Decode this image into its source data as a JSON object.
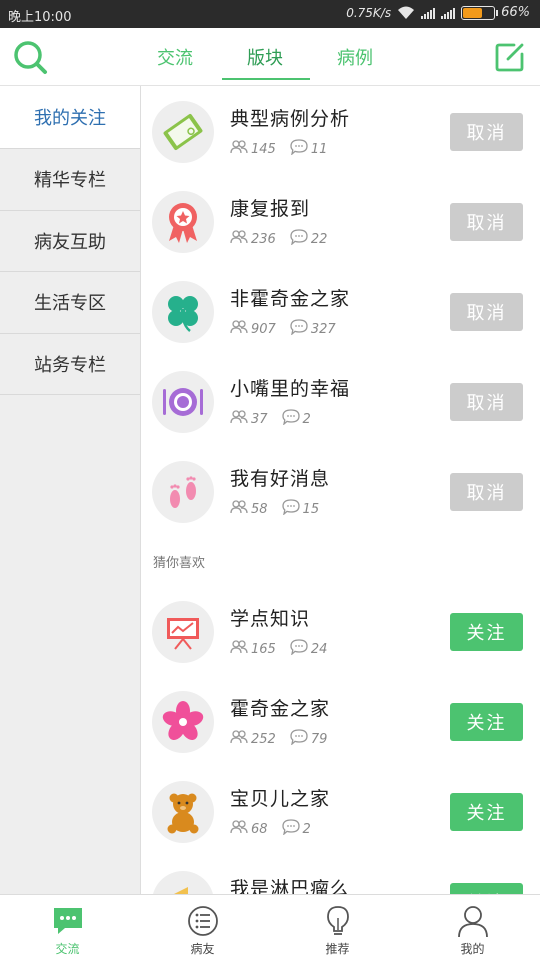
{
  "status": {
    "time": "晚上10:00",
    "network": "0.75K/s",
    "battery": "66%",
    "battery_level": 0.66
  },
  "nav": {
    "tabs": [
      {
        "label": "交流",
        "active": false
      },
      {
        "label": "版块",
        "active": true
      },
      {
        "label": "病例",
        "active": false
      }
    ],
    "icons": {
      "left": "search-icon",
      "right": "edit-icon"
    }
  },
  "sidebar": {
    "items": [
      {
        "label": "我的关注",
        "active": true
      },
      {
        "label": "精华专栏",
        "active": false
      },
      {
        "label": "病友互助",
        "active": false
      },
      {
        "label": "生活专区",
        "active": false
      },
      {
        "label": "站务专栏",
        "active": false
      }
    ]
  },
  "followed": [
    {
      "title": "典型病例分析",
      "members": "145",
      "comments": "11",
      "action": "取消",
      "icon": "book-icon",
      "color": "#8bc34a"
    },
    {
      "title": "康复报到",
      "members": "236",
      "comments": "22",
      "action": "取消",
      "icon": "ribbon-icon",
      "color": "#f06262"
    },
    {
      "title": "非霍奇金之家",
      "members": "907",
      "comments": "327",
      "action": "取消",
      "icon": "clover-icon",
      "color": "#26b08c"
    },
    {
      "title": "小嘴里的幸福",
      "members": "37",
      "comments": "2",
      "action": "取消",
      "icon": "plate-icon",
      "color": "#a66cd6"
    },
    {
      "title": "我有好消息",
      "members": "58",
      "comments": "15",
      "action": "取消",
      "icon": "footprints-icon",
      "color": "#f28bb0"
    }
  ],
  "recommend_label": "猜你喜欢",
  "recommended": [
    {
      "title": "学点知识",
      "members": "165",
      "comments": "24",
      "action": "关注",
      "icon": "presentation-icon",
      "color": "#f05a5a"
    },
    {
      "title": "霍奇金之家",
      "members": "252",
      "comments": "79",
      "action": "关注",
      "icon": "flower-icon",
      "color": "#f0509a"
    },
    {
      "title": "宝贝儿之家",
      "members": "68",
      "comments": "2",
      "action": "关注",
      "icon": "teddy-bear-icon",
      "color": "#d98a1e"
    },
    {
      "title": "我是淋巴瘤么",
      "members": "",
      "comments": "",
      "action": "关注",
      "icon": "megaphone-icon",
      "color": "#f2c14e"
    }
  ],
  "bottom_nav": [
    {
      "label": "交流",
      "icon": "chat-icon",
      "active": true
    },
    {
      "label": "病友",
      "icon": "list-icon",
      "active": false
    },
    {
      "label": "推荐",
      "icon": "bulb-icon",
      "active": false
    },
    {
      "label": "我的",
      "icon": "user-icon",
      "active": false
    }
  ]
}
